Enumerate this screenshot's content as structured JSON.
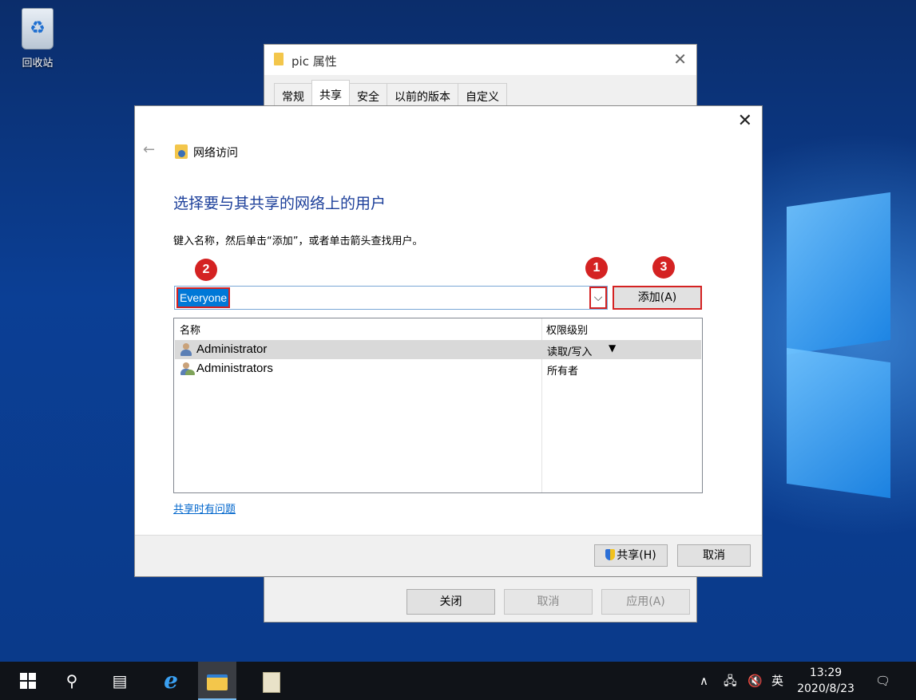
{
  "desktop": {
    "recycle_bin_label": "回收站"
  },
  "properties_dialog": {
    "title": "pic 属性",
    "tabs": [
      "常规",
      "共享",
      "安全",
      "以前的版本",
      "自定义"
    ],
    "active_tab": "共享",
    "buttons": {
      "close": "关闭",
      "cancel": "取消",
      "apply": "应用(A)"
    }
  },
  "wizard": {
    "nav_title": "网络访问",
    "heading": "选择要与其共享的网络上的用户",
    "instruction": "键入名称，然后单击“添加”，或者单击箭头查找用户。",
    "markers": [
      "1",
      "2",
      "3"
    ],
    "user_input_value": "Everyone",
    "add_button": "添加(A)",
    "table": {
      "columns": [
        "名称",
        "权限级别"
      ],
      "rows": [
        {
          "name": "Administrator",
          "permission": "读取/写入",
          "has_dropdown": true,
          "icon": "user-icon"
        },
        {
          "name": "Administrators",
          "permission": "所有者",
          "has_dropdown": false,
          "icon": "users-group-icon"
        }
      ]
    },
    "help_link": "共享时有问题",
    "share_button": "共享(H)",
    "cancel_button": "取消"
  },
  "taskbar": {
    "input_language": "英",
    "time": "13:29",
    "date": "2020/8/23"
  },
  "colors": {
    "accent": "#0078d7",
    "heading_blue": "#1c3f9a",
    "marker_red": "#d42222",
    "link_blue": "#0066cc",
    "taskbar": "#101318"
  }
}
